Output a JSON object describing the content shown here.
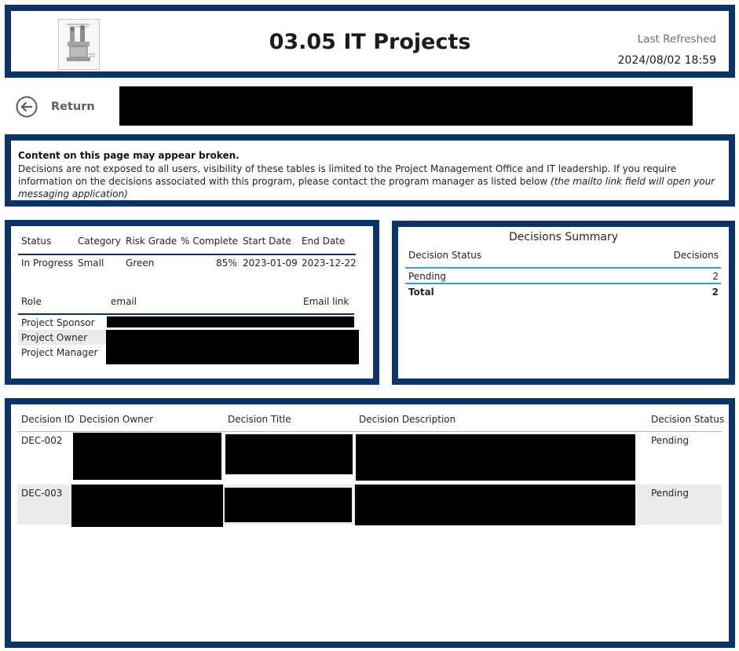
{
  "header": {
    "title": "03.05 IT Projects",
    "last_refreshed_label": "Last Refreshed",
    "last_refreshed_value": "2024/08/02 18:59",
    "logo_icon": "logo-icon"
  },
  "nav": {
    "return_label": "Return",
    "return_icon": "arrow-left-circle-icon"
  },
  "notice": {
    "title": "Content on this page may appear broken.",
    "text": "Decisions are not exposed to all users, visibility of these tables is limited to the Project Management Office and IT leadership. If you require information on the decisions associated with this program, please contact the program manager as listed below ",
    "note": "(the mailto link field will open your messaging application)"
  },
  "project": {
    "columns": [
      "Status",
      "Category",
      "Risk Grade",
      "% Complete",
      "Start Date",
      "End Date"
    ],
    "row": {
      "status": "In Progress",
      "category": "Small",
      "risk_grade": "Green",
      "complete": "85%",
      "start_date": "2023-01-09",
      "end_date": "2023-12-22"
    }
  },
  "contacts": {
    "columns": [
      "Role",
      "email",
      "Email link"
    ],
    "roles": [
      "Project Sponsor",
      "Project Owner",
      "Project Manager"
    ]
  },
  "summary": {
    "title": "Decisions Summary",
    "columns": [
      "Decision Status",
      "Decisions"
    ],
    "rows": [
      {
        "status": "Pending",
        "count": "2"
      }
    ],
    "total_label": "Total",
    "total_value": "2"
  },
  "decisions": {
    "columns": [
      "Decision ID",
      "Decision Owner",
      "Decision Title",
      "Decision Description",
      "Decision Status"
    ],
    "rows": [
      {
        "id": "DEC-002",
        "status": "Pending"
      },
      {
        "id": "DEC-003",
        "status": "Pending"
      }
    ]
  },
  "more_options": "..."
}
